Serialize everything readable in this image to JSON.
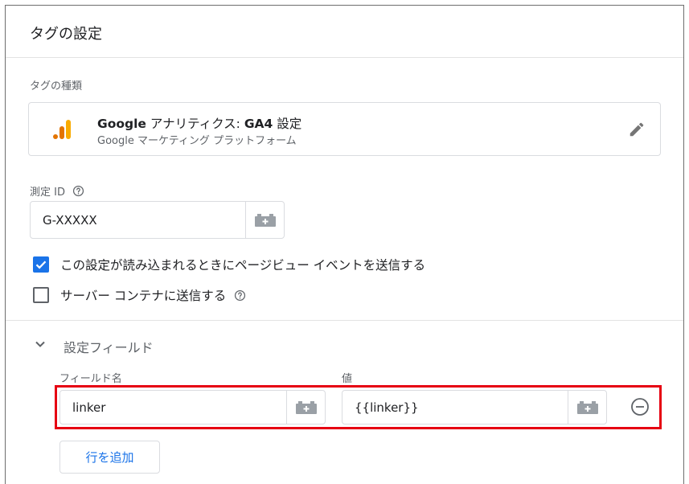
{
  "header": {
    "title": "タグの設定"
  },
  "tag_type": {
    "label": "タグの種類",
    "name_bold": "Google",
    "name_rest": " アナリティクス: ",
    "name_suffix": "GA4",
    "name_tail": " 設定",
    "subtitle": "Google マーケティング プラットフォーム",
    "icons": {
      "logo": "google-analytics-icon",
      "edit": "pencil-icon"
    }
  },
  "measurement_id": {
    "label": "測定 ID",
    "value": "G-XXXXX",
    "icons": {
      "help": "help-circle-icon",
      "variable": "variable-brick-icon"
    }
  },
  "checkboxes": [
    {
      "label": "この設定が読み込まれるときにページビュー イベントを送信する",
      "checked": true
    },
    {
      "label": "サーバー コンテナに送信する",
      "checked": false
    }
  ],
  "fields_section": {
    "title": "設定フィールド",
    "expanded": true,
    "columns": {
      "name": "フィールド名",
      "value": "値"
    },
    "rows": [
      {
        "name": "linker",
        "value": "{{linker}}"
      }
    ],
    "add_row_label": "行を追加"
  },
  "colors": {
    "accent": "#1a73e8",
    "highlight": "#e60012",
    "ga_orange": "#f9ab00",
    "ga_dark_orange": "#e37400"
  }
}
